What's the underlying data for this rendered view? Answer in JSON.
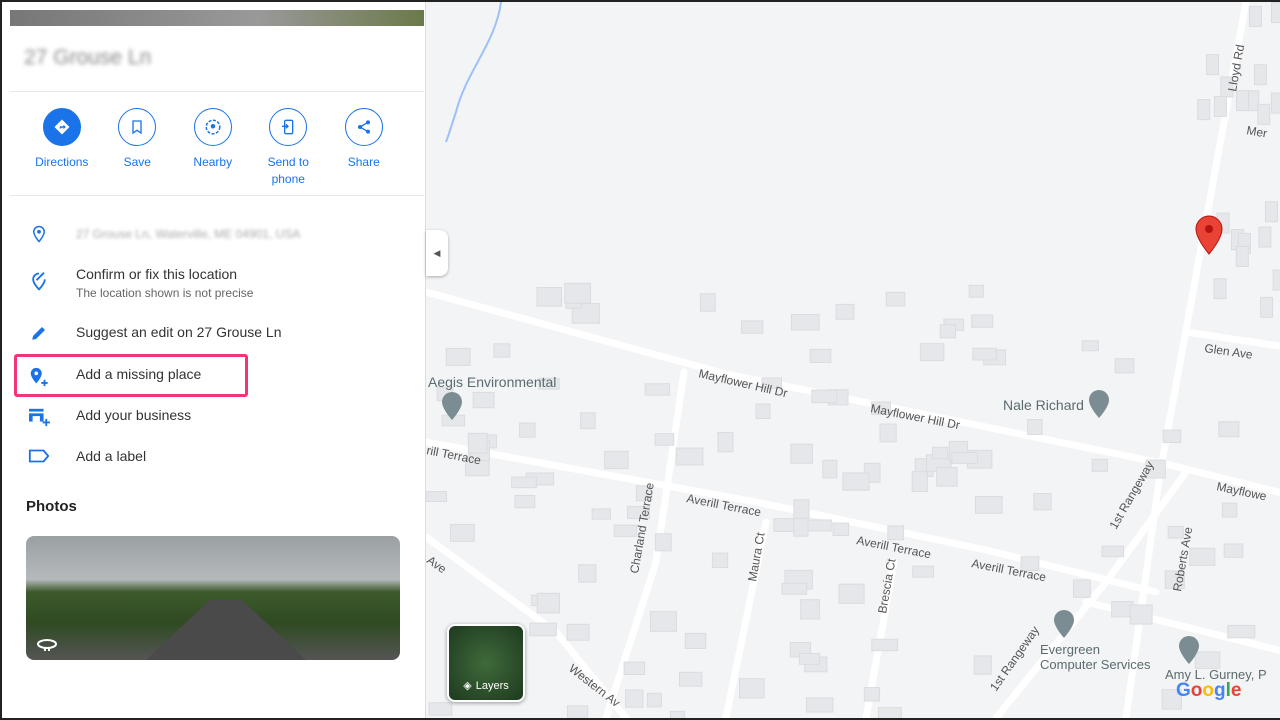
{
  "place": {
    "title": "27 Grouse Ln"
  },
  "actions": [
    {
      "label": "Directions",
      "icon": "directions-icon"
    },
    {
      "label": "Save",
      "icon": "bookmark-icon"
    },
    {
      "label": "Nearby",
      "icon": "nearby-icon"
    },
    {
      "label": "Send to phone",
      "icon": "send-to-phone-icon"
    },
    {
      "label": "Share",
      "icon": "share-icon"
    }
  ],
  "info": {
    "address": "27 Grouse Ln, Waterville, ME 04901, USA",
    "confirm": "Confirm or fix this location",
    "confirm_sub": "The location shown is not precise",
    "suggest": "Suggest an edit on 27 Grouse Ln",
    "add_place": "Add a missing place",
    "add_business": "Add your business",
    "add_label": "Add a label"
  },
  "photos": {
    "heading": "Photos"
  },
  "map": {
    "streets": [
      "Mayflower Hill Dr",
      "Mayflower Hill Dr",
      "Averill Terrace",
      "Averill Terrace",
      "Averill Terrace",
      "rill Terrace",
      "Charland Terrace",
      "Maura Ct",
      "Brescia Ct",
      "1st Rangeway",
      "1st Rangeway",
      "Roberts Ave",
      "Western Av",
      "Glen Ave",
      "Lloyd Rd",
      "Mer",
      "Mayflowe",
      "Ave"
    ],
    "places": [
      "Aegis Environmental",
      "Nale Richard",
      "Evergreen",
      "Computer Services",
      "Amy L. Gurney, P"
    ],
    "layers_label": "Layers",
    "logo": "Google"
  },
  "colors": {
    "accent": "#1a73e8",
    "highlight": "#f0357a",
    "pin": "#ea4335"
  }
}
